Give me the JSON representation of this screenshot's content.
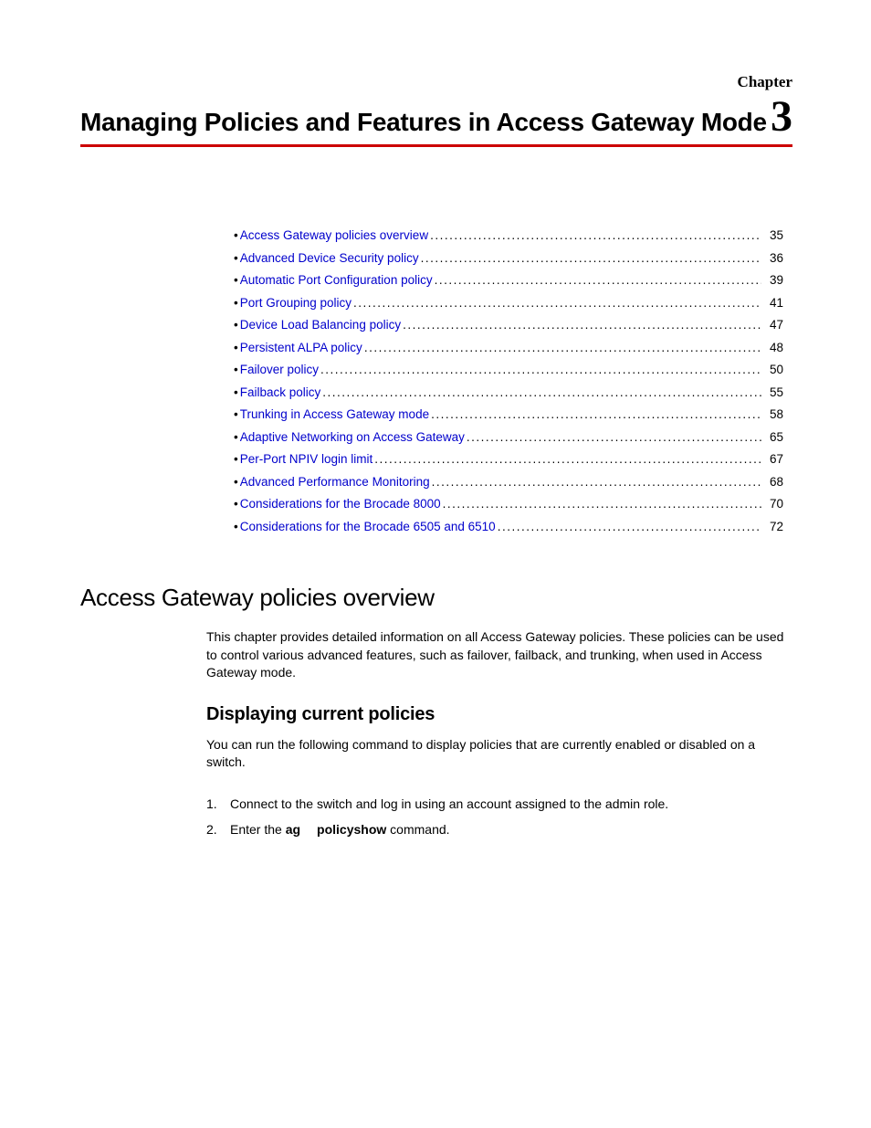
{
  "chapter_label": "Chapter",
  "chapter_number": "3",
  "chapter_title": "Managing Policies and Features in Access Gateway Mode",
  "toc": [
    {
      "label": "Access Gateway policies overview",
      "page": "35"
    },
    {
      "label": "Advanced Device Security policy",
      "page": "36"
    },
    {
      "label": "Automatic Port Configuration policy",
      "page": "39"
    },
    {
      "label": "Port Grouping policy",
      "page": "41"
    },
    {
      "label": "Device Load Balancing policy",
      "page": "47"
    },
    {
      "label": "Persistent ALPA policy",
      "page": "48"
    },
    {
      "label": "Failover policy",
      "page": "50"
    },
    {
      "label": "Failback policy",
      "page": "55"
    },
    {
      "label": "Trunking in Access Gateway mode",
      "page": "58"
    },
    {
      "label": "Adaptive Networking on Access Gateway",
      "page": "65"
    },
    {
      "label": "Per-Port NPIV login limit",
      "page": "67"
    },
    {
      "label": "Advanced Performance Monitoring",
      "page": "68"
    },
    {
      "label": "Considerations for the Brocade 8000",
      "page": "70"
    },
    {
      "label": "Considerations for the Brocade 6505 and 6510",
      "page": "72"
    }
  ],
  "section": {
    "heading": "Access Gateway policies overview",
    "intro": "This chapter provides detailed information on all Access Gateway policies. These policies can be used to control various advanced features, such as failover, failback, and trunking, when used in Access Gateway mode.",
    "sub_heading": "Displaying current policies",
    "sub_intro": "You can run the following command to display policies that are currently enabled or disabled on a switch.",
    "steps": [
      {
        "num": "1.",
        "text": "Connect to the switch and log in using an account assigned to the admin role."
      },
      {
        "num": "2.",
        "prefix": "Enter the ",
        "cmd1": "ag",
        "cmd2": "policyshow",
        "suffix": " command."
      }
    ]
  }
}
